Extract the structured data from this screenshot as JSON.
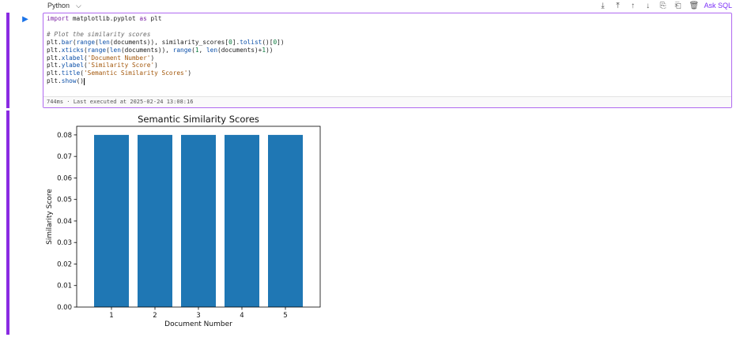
{
  "header": {
    "language": "Python",
    "ask_label": "Ask SQL",
    "toolbar_icons": [
      "share-icon",
      "pin-icon",
      "arrow-up-icon",
      "arrow-down-icon",
      "copy-icon",
      "paste-icon",
      "trash-icon"
    ]
  },
  "cell": {
    "code_lines": [
      "import matplotlib.pyplot as plt",
      "",
      "# Plot the similarity scores",
      "plt.bar(range(len(documents)), similarity_scores[0].tolist()[0])",
      "plt.xticks(range(len(documents)), range(1, len(documents)+1))",
      "plt.xlabel('Document Number')",
      "plt.ylabel('Similarity Score')",
      "plt.title('Semantic Similarity Scores')",
      "plt.show()"
    ],
    "status": "744ms · Last executed at 2025-02-24 13:08:16"
  },
  "chart_data": {
    "type": "bar",
    "title": "Semantic Similarity Scores",
    "xlabel": "Document Number",
    "ylabel": "Similarity Score",
    "categories": [
      "1",
      "2",
      "3",
      "4",
      "5"
    ],
    "values": [
      0.08,
      0.08,
      0.08,
      0.08,
      0.08
    ],
    "ylim": [
      0,
      0.084
    ],
    "yticks": [
      "0.00",
      "0.01",
      "0.02",
      "0.03",
      "0.04",
      "0.05",
      "0.06",
      "0.07",
      "0.08"
    ],
    "bar_color": "#1f77b4"
  },
  "colors": {
    "accent": "#8a2be2",
    "run": "#1a73e8"
  }
}
